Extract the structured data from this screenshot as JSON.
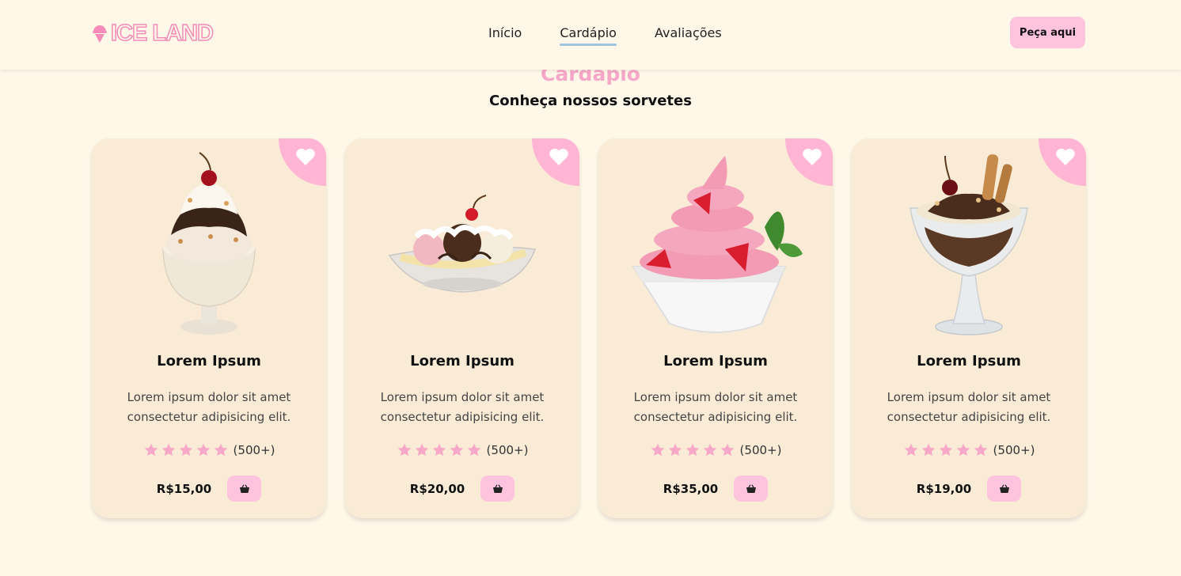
{
  "header": {
    "logo_text": "ICE LAND",
    "nav": [
      {
        "label": "Início"
      },
      {
        "label": "Cardápio"
      },
      {
        "label": "Avaliações"
      }
    ],
    "order_button": "Peça aqui"
  },
  "section": {
    "title": "Cardápio",
    "subtitle": "Conheça nossos sorvetes"
  },
  "products": [
    {
      "title": "Lorem Ipsum",
      "description": "Lorem ipsum dolor sit amet consectetur adipisicing elit.",
      "rating": 5,
      "reviews": "(500+)",
      "price": "R$15,00"
    },
    {
      "title": "Lorem Ipsum",
      "description": "Lorem ipsum dolor sit amet consectetur adipisicing elit.",
      "rating": 5,
      "reviews": "(500+)",
      "price": "R$20,00"
    },
    {
      "title": "Lorem Ipsum",
      "description": "Lorem ipsum dolor sit amet consectetur adipisicing elit.",
      "rating": 5,
      "reviews": "(500+)",
      "price": "R$35,00"
    },
    {
      "title": "Lorem Ipsum",
      "description": "Lorem ipsum dolor sit amet consectetur adipisicing elit.",
      "rating": 5,
      "reviews": "(500+)",
      "price": "R$19,00"
    }
  ],
  "icons": {
    "logo": "ice-cream-icon",
    "favorite": "heart-icon",
    "rating": "star-icon",
    "cart": "basket-icon"
  },
  "colors": {
    "background": "#fff8e9",
    "card": "#faebd7",
    "pink_accent": "#ffc4dd",
    "star": "#f7a7c8",
    "nav_underline": "#9fc3e0"
  }
}
